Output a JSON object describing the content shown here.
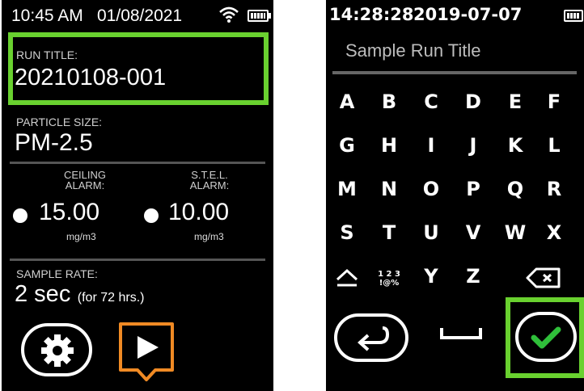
{
  "left": {
    "status": {
      "time": "10:45 AM",
      "date": "01/08/2021"
    },
    "run_title": {
      "label": "RUN TITLE:",
      "value": "20210108-001"
    },
    "particle_size": {
      "label": "PARTICLE SIZE:",
      "value": "PM-2.5"
    },
    "ceiling_alarm": {
      "label_line1": "CEILING",
      "label_line2": "ALARM:",
      "value": "15.00",
      "unit": "mg/m3"
    },
    "stel_alarm": {
      "label_line1": "S.T.E.L.",
      "label_line2": "ALARM:",
      "value": "10.00",
      "unit": "mg/m3"
    },
    "sample_rate": {
      "label": "SAMPLE RATE:",
      "value": "2 sec",
      "note": "(for 72 hrs.)"
    },
    "icons": {
      "settings": "gear-icon",
      "start": "play-icon",
      "wifi": "wifi-icon",
      "battery": "battery-icon"
    },
    "accent_color": "#69d12f",
    "play_color": "#f08a24"
  },
  "right": {
    "status": {
      "time": "14:28:28",
      "date": "2019-07-07"
    },
    "title_placeholder": "Sample Run Title",
    "keys": [
      [
        "A",
        "B",
        "C",
        "D",
        "E",
        "F"
      ],
      [
        "G",
        "H",
        "I",
        "J",
        "K",
        "L"
      ],
      [
        "M",
        "N",
        "O",
        "P",
        "Q",
        "R"
      ],
      [
        "S",
        "T",
        "U",
        "V",
        "W",
        "X"
      ]
    ],
    "last_row": {
      "symbols_top": "1 2 3",
      "symbols_bottom": "!@%",
      "y": "Y",
      "z": "Z"
    },
    "icons": {
      "shift": "shift-icon",
      "backspace": "backspace-icon",
      "enter": "enter-icon",
      "space": "space-icon",
      "confirm": "checkmark-icon"
    },
    "check_color": "#2fbf3a"
  }
}
